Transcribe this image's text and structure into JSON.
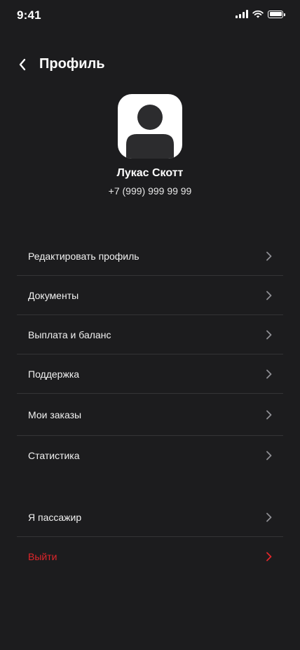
{
  "status_bar": {
    "time": "9:41",
    "icons": [
      "signal-icon",
      "wifi-icon",
      "battery-icon"
    ]
  },
  "header": {
    "title": "Профиль",
    "back_icon": "chevron-left-icon"
  },
  "profile": {
    "name": "Лукас Скотт",
    "phone": "+7 (999) 999 99 99",
    "avatar_icon": "user-silhouette-icon"
  },
  "menu": {
    "items": [
      {
        "label": "Редактировать профиль"
      },
      {
        "label": "Документы"
      },
      {
        "label": "Выплата и баланс"
      },
      {
        "label": "Поддержка"
      },
      {
        "label": "Мои заказы"
      },
      {
        "label": "Статистика"
      }
    ]
  },
  "secondary_menu": {
    "items": [
      {
        "label": "Я пассажир"
      },
      {
        "label": "Выйти"
      }
    ]
  },
  "colors": {
    "background": "#1c1c1e",
    "text": "#ffffff",
    "divider": "#343436",
    "chevron": "#8e8e93",
    "danger": "#e0262b"
  }
}
